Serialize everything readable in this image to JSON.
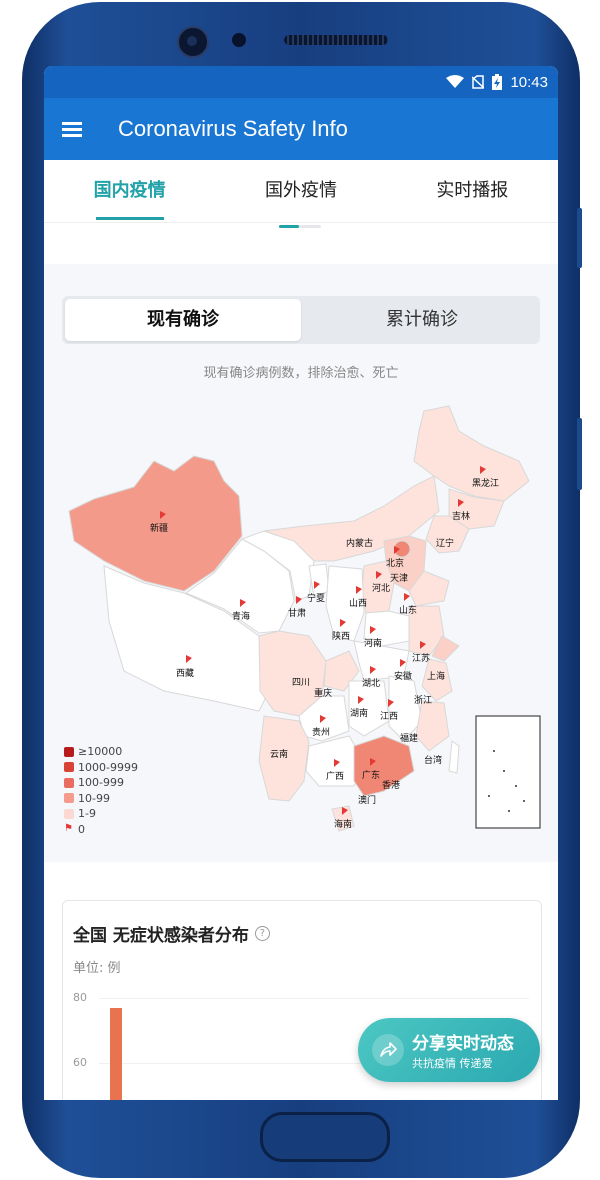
{
  "status": {
    "time": "10:43"
  },
  "appbar": {
    "title": "Coronavirus Safety Info"
  },
  "tabs": [
    {
      "label": "国内疫情",
      "active": true
    },
    {
      "label": "国外疫情",
      "active": false
    },
    {
      "label": "实时播报",
      "active": false
    }
  ],
  "toggle": {
    "current": "现有确诊",
    "cumulative": "累计确诊"
  },
  "map": {
    "subtitle": "现有确诊病例数，排除治愈、死亡",
    "provinces": [
      "新疆",
      "西藏",
      "青海",
      "甘肃",
      "宁夏",
      "内蒙古",
      "黑龙江",
      "吉林",
      "辽宁",
      "北京",
      "天津",
      "河北",
      "山西",
      "山东",
      "陕西",
      "河南",
      "江苏",
      "上海",
      "四川",
      "重庆",
      "湖北",
      "安徽",
      "浙江",
      "贵州",
      "湖南",
      "江西",
      "福建",
      "云南",
      "广西",
      "广东",
      "香港",
      "澳门",
      "台湾",
      "海南"
    ],
    "legend": [
      "≥10000",
      "1000-9999",
      "100-999",
      "10-99",
      "1-9",
      "0"
    ],
    "legend_colors": [
      "#b71c1c",
      "#d84336",
      "#ea6b5f",
      "#f49b8c",
      "#fbd9d2",
      "#ffffff"
    ]
  },
  "chart": {
    "title": "全国 无症状感染者分布",
    "help": "?",
    "unit": "单位: 例",
    "y_ticks": [
      "80",
      "60"
    ]
  },
  "chart_data": {
    "type": "bar",
    "title": "全国 无症状感染者分布",
    "ylabel": "单位: 例",
    "values": [
      77
    ],
    "ylim": [
      0,
      80
    ]
  },
  "fab": {
    "title": "分享实时动态",
    "subtitle": "共抗疫情 传递爱",
    "icon": "share-icon"
  }
}
